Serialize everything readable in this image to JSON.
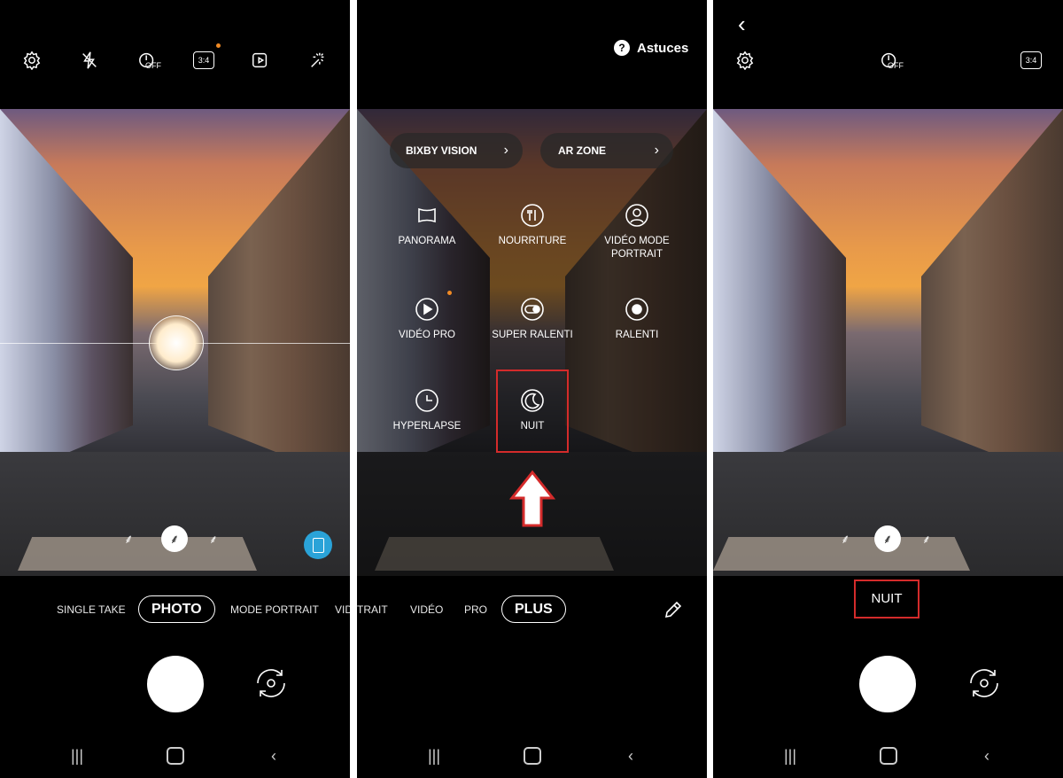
{
  "panel1": {
    "top_icons": [
      "gear-icon",
      "flash-off-icon",
      "timer-off-icon",
      "ratio-icon",
      "motion-photo-icon",
      "effects-icon"
    ],
    "timer_label": "OFF",
    "ratio_label": "3:4",
    "modes": [
      "SINGLE TAKE",
      "PHOTO",
      "MODE PORTRAIT",
      "VIDÉO PORTRAIT"
    ],
    "selected_mode": "PHOTO"
  },
  "panel2": {
    "tips_label": "Astuces",
    "pills": [
      "BIXBY VISION",
      "AR ZONE"
    ],
    "menu_items": [
      {
        "label": "PANORAMA",
        "icon": "panorama-icon"
      },
      {
        "label": "NOURRITURE",
        "icon": "food-icon"
      },
      {
        "label": "VIDÉO MODE PORTRAIT",
        "icon": "portrait-video-icon"
      },
      {
        "label": "VIDÉO PRO",
        "icon": "pro-video-icon"
      },
      {
        "label": "SUPER RALENTI",
        "icon": "super-slow-icon"
      },
      {
        "label": "RALENTI",
        "icon": "slow-motion-icon"
      },
      {
        "label": "HYPERLAPSE",
        "icon": "hyperlapse-icon"
      },
      {
        "label": "NUIT",
        "icon": "night-icon"
      }
    ],
    "modes": [
      "TRAIT",
      "VIDÉO",
      "PRO",
      "PLUS"
    ],
    "selected_mode": "PLUS",
    "highlight_color": "#d42b2b"
  },
  "panel3": {
    "timer_label": "OFF",
    "ratio_label": "3:4",
    "mode_label": "NUIT"
  }
}
